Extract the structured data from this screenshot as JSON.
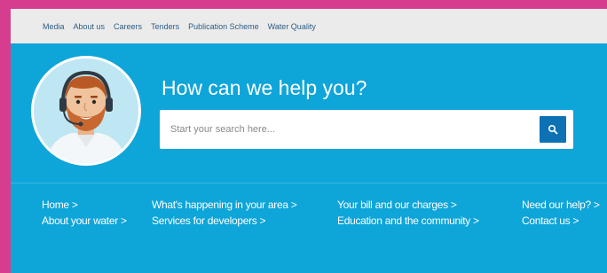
{
  "topnav": {
    "items": [
      {
        "label": "Media"
      },
      {
        "label": "About us"
      },
      {
        "label": "Careers"
      },
      {
        "label": "Tenders"
      },
      {
        "label": "Publication Scheme"
      },
      {
        "label": "Water Quality"
      }
    ]
  },
  "hero": {
    "heading": "How can we help you?",
    "search_placeholder": "Start your search here...",
    "search_icon": "search-icon",
    "avatar_icon": "support-agent-avatar"
  },
  "quicklinks": {
    "col1": [
      "Home >",
      "About your water >"
    ],
    "col2": [
      "What's happening in your area >",
      "Services for developers >"
    ],
    "col3": [
      "Your bill and our charges >",
      "Education and the community >"
    ],
    "col4": [
      "Need our help? >",
      "Contact us >"
    ]
  },
  "colors": {
    "frame_pink": "#d63d8e",
    "hero_blue": "#0ea5d9",
    "topbar_grey": "#ebebeb",
    "search_button": "#0c72b4"
  }
}
